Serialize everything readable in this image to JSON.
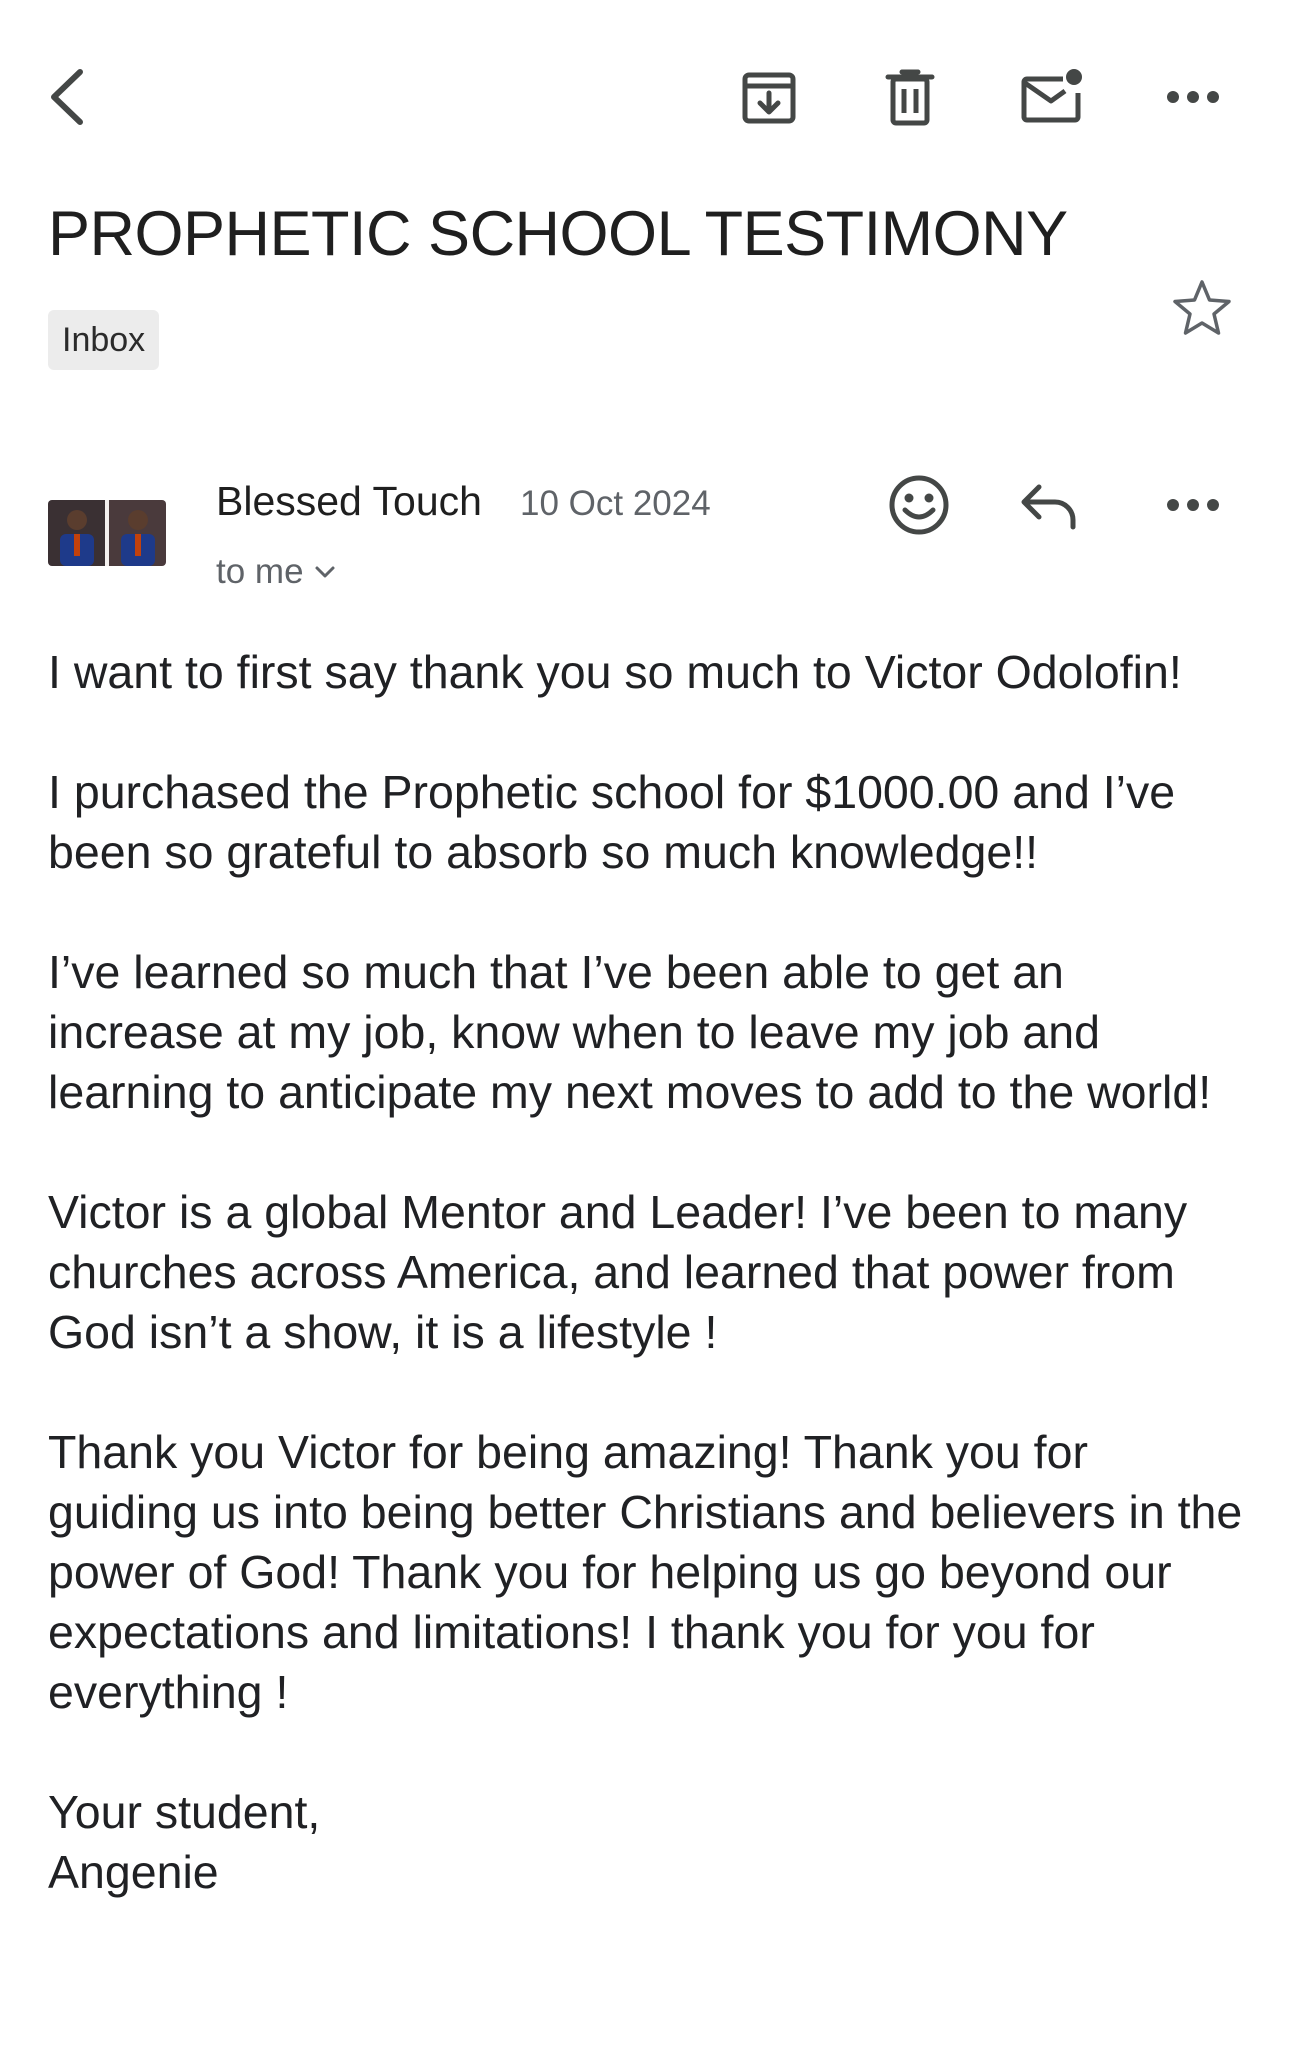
{
  "toolbar": {
    "back_icon": "chevron-left-icon",
    "archive_icon": "archive-icon",
    "delete_icon": "trash-icon",
    "mark_unread_icon": "mail-unread-icon",
    "more_icon": "more-horizontal-icon"
  },
  "email": {
    "subject": "PROPHETIC SCHOOL TESTIMONY",
    "label": "Inbox",
    "star_icon": "star-outline-icon",
    "sender": {
      "name": "Blessed Touch",
      "date": "10 Oct 2024",
      "recipient": "to me",
      "avatar": "avatar-photo"
    },
    "message_actions": {
      "react_icon": "smiley-icon",
      "reply_icon": "reply-icon",
      "more_icon": "more-horizontal-icon"
    },
    "body": [
      "I want to first say thank you so much to Victor Odolofin!",
      "I purchased the Prophetic school for $1000.00 and I’ve been so grateful to absorb so much knowledge!!",
      "I’ve learned so much that I’ve been able to get an increase at my job, know when to leave my job and learning to anticipate my next moves to add to the world!",
      "Victor is a global Mentor and Leader! I’ve been to many churches across America, and learned that power from God isn’t a show, it is a lifestyle !",
      "Thank you Victor for being amazing! Thank you for guiding us into being better Christians and believers in the power of God! Thank you for helping us go beyond our expectations and limitations! I thank you for you for everything !"
    ],
    "signoff": [
      "Your student,",
      "Angenie"
    ]
  },
  "colors": {
    "icon": "#444746",
    "text": "#1f1f1f",
    "secondary_text": "#5f6368",
    "chip_bg": "#ececec"
  }
}
